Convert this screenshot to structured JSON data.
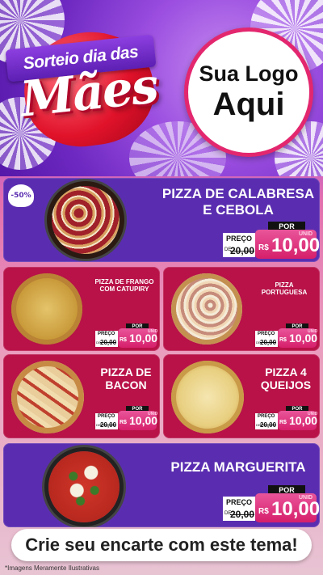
{
  "header": {
    "ribbon_text": "Sorteio dia das",
    "title": "Mães",
    "logo_line1": "Sua Logo",
    "logo_line2": "Aqui"
  },
  "price_labels": {
    "por": "POR",
    "preco": "PREÇO",
    "de": "DE",
    "currency": "R$",
    "unit": "UNID"
  },
  "products": [
    {
      "name": "PIZZA DE CALABRESA E CEBOLA",
      "badge": "-50%",
      "old_price": "20,00",
      "new_price": "10,00"
    },
    {
      "name": "PIZZA DE FRANGO COM CATUPIRY",
      "old_price": "20,00",
      "new_price": "10,00"
    },
    {
      "name": "PIZZA PORTUGUESA",
      "old_price": "20,00",
      "new_price": "10,00"
    },
    {
      "name": "PIZZA DE BACON",
      "old_price": "20,00",
      "new_price": "10,00"
    },
    {
      "name": "PIZZA 4 QUEIJOS",
      "old_price": "20,00",
      "new_price": "10,00"
    },
    {
      "name": "PIZZA MARGUERITA",
      "old_price": "20,00",
      "new_price": "10,00"
    }
  ],
  "cta": "Crie seu encarte com este tema!",
  "disclaimer": "*Imagens Meramente Ilustrativas",
  "colors": {
    "purple_card": "#5a2db0",
    "red_card": "#b81248",
    "price_pink": "#d61f6b",
    "logo_border": "#e3276f"
  }
}
